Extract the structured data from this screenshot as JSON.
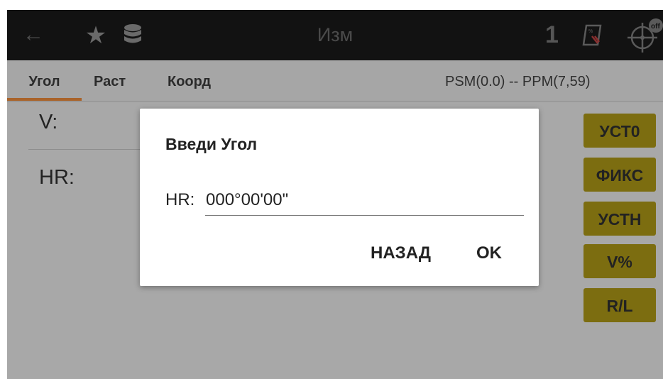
{
  "header": {
    "title": "Изм",
    "level_indicator": "1",
    "icons": [
      "back-arrow-icon",
      "star-icon",
      "database-icon",
      "sheet-icon",
      "target-off-icon"
    ],
    "target_badge": "off"
  },
  "tabs": [
    {
      "label": "Угол",
      "active": true
    },
    {
      "label": "Раст",
      "active": false
    },
    {
      "label": "Коорд",
      "active": false
    }
  ],
  "status_text": "PSM(0.0) -- PPM(7,59)",
  "measurements": {
    "v_label": "V:",
    "hr_label": "HR:"
  },
  "function_buttons": [
    "УСТ0",
    "ФИКС",
    "УСТН",
    "V%",
    "R/L"
  ],
  "dialog": {
    "title": "Введи Угол",
    "field_label": "HR:",
    "field_value": "000°00'00\"",
    "back_label": "НАЗАД",
    "ok_label": "OK"
  },
  "colors": {
    "title_bar": "#121212",
    "tab_underline": "#a9632a",
    "function_button": "#7c6d10",
    "overlay_background": "#a8a8a8",
    "dialog_background": "#ffffff"
  }
}
